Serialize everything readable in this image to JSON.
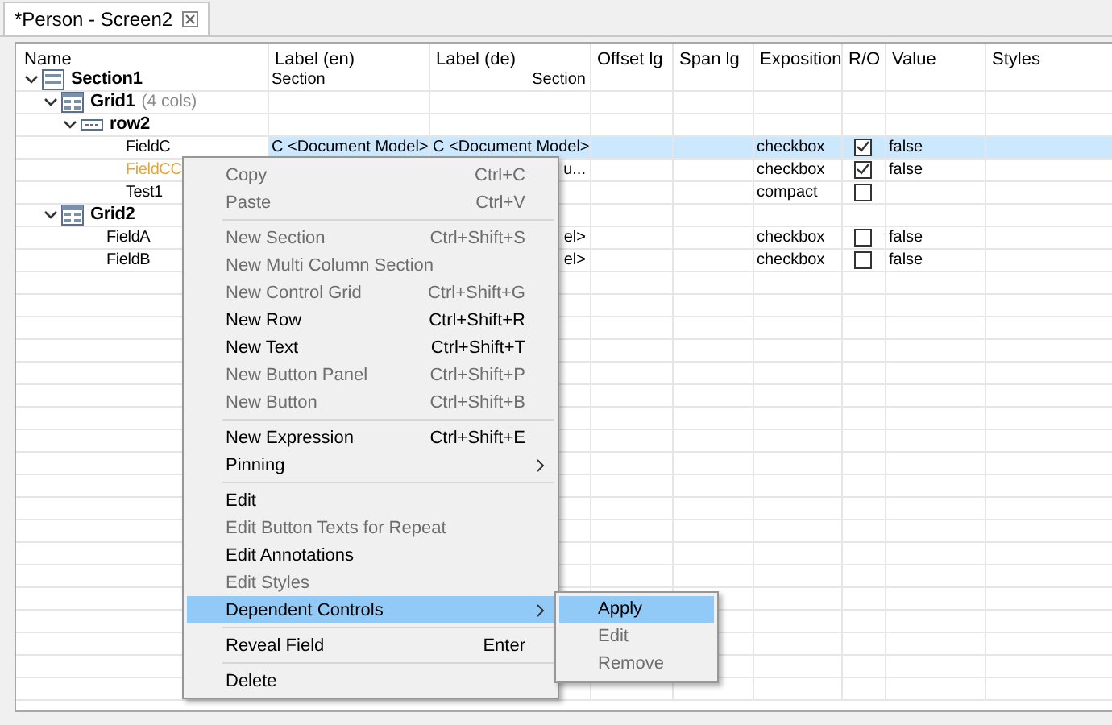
{
  "tab": {
    "title": "*Person - Screen2",
    "selected": true
  },
  "table": {
    "columns": [
      "Name",
      "Label (en)",
      "Label (de)",
      "Offset lg",
      "Span lg",
      "Exposition",
      "R/O",
      "Value",
      "Styles"
    ],
    "rows": [
      {
        "name": "Section1",
        "kind": "section",
        "expanded": true,
        "selected": false,
        "label_en": "Section",
        "label_de": "Section",
        "children": [
          {
            "name": "Grid1",
            "note": "(4 cols)",
            "kind": "grid",
            "expanded": true,
            "selected": false,
            "children": [
              {
                "name": "row2",
                "kind": "row",
                "expanded": true,
                "selected": false,
                "children": [
                  {
                    "name": "FieldC",
                    "color": "#000000",
                    "selected": true,
                    "label_en": "C <Document Model>",
                    "label_de": "C <Document Model>",
                    "exposition": "checkbox",
                    "read_only": true,
                    "value": "false"
                  },
                  {
                    "name": "FieldCC",
                    "color": "#e3a43a",
                    "selected": false,
                    "label_de": "u...",
                    "exposition": "checkbox",
                    "read_only": true,
                    "value": "false"
                  },
                  {
                    "name": "Test1",
                    "color": "#000000",
                    "selected": false,
                    "exposition": "compact",
                    "read_only": false
                  }
                ]
              }
            ]
          },
          {
            "name": "Grid2",
            "kind": "grid",
            "expanded": true,
            "selected": false,
            "children": [
              {
                "name": "FieldA",
                "color": "#000000",
                "selected": false,
                "label_de": "el>",
                "exposition": "checkbox",
                "read_only": false,
                "value": "false"
              },
              {
                "name": "FieldB",
                "color": "#000000",
                "selected": false,
                "label_de": "el>",
                "exposition": "checkbox",
                "read_only": false,
                "value": "false"
              }
            ]
          }
        ]
      }
    ]
  },
  "context_menu": {
    "items": [
      {
        "kind": "item",
        "label": "Copy",
        "shortcut": "Ctrl+C",
        "disabled": true,
        "selected": false
      },
      {
        "kind": "item",
        "label": "Paste",
        "shortcut": "Ctrl+V",
        "disabled": true,
        "selected": false
      },
      {
        "kind": "separator"
      },
      {
        "kind": "item",
        "label": "New Section",
        "shortcut": "Ctrl+Shift+S",
        "disabled": true,
        "selected": false
      },
      {
        "kind": "item",
        "label": "New Multi Column Section",
        "disabled": true,
        "selected": false
      },
      {
        "kind": "item",
        "label": "New Control Grid",
        "shortcut": "Ctrl+Shift+G",
        "disabled": true,
        "selected": false
      },
      {
        "kind": "item",
        "label": "New Row",
        "shortcut": "Ctrl+Shift+R",
        "disabled": false,
        "selected": false
      },
      {
        "kind": "item",
        "label": "New Text",
        "shortcut": "Ctrl+Shift+T",
        "disabled": false,
        "selected": false
      },
      {
        "kind": "item",
        "label": "New Button Panel",
        "shortcut": "Ctrl+Shift+P",
        "disabled": true,
        "selected": false
      },
      {
        "kind": "item",
        "label": "New Button",
        "shortcut": "Ctrl+Shift+B",
        "disabled": true,
        "selected": false
      },
      {
        "kind": "separator"
      },
      {
        "kind": "item",
        "label": "New Expression",
        "shortcut": "Ctrl+Shift+E",
        "disabled": false,
        "selected": false
      },
      {
        "kind": "item",
        "label": "Pinning",
        "has_submenu": true,
        "disabled": false,
        "selected": false
      },
      {
        "kind": "separator"
      },
      {
        "kind": "item",
        "label": "Edit",
        "disabled": false,
        "selected": false
      },
      {
        "kind": "item",
        "label": "Edit Button Texts for Repeat",
        "disabled": true,
        "selected": false
      },
      {
        "kind": "item",
        "label": "Edit Annotations",
        "disabled": false,
        "selected": false
      },
      {
        "kind": "item",
        "label": "Edit Styles",
        "disabled": true,
        "selected": false
      },
      {
        "kind": "item",
        "label": "Dependent Controls",
        "has_submenu": true,
        "disabled": false,
        "selected": true,
        "submenu": [
          {
            "label": "Apply",
            "disabled": false,
            "selected": true
          },
          {
            "label": "Edit",
            "disabled": true,
            "selected": false
          },
          {
            "label": "Remove",
            "disabled": true,
            "selected": false
          }
        ]
      },
      {
        "kind": "separator"
      },
      {
        "kind": "item",
        "label": "Reveal Field",
        "shortcut": "Enter",
        "disabled": false,
        "selected": false
      },
      {
        "kind": "separator"
      },
      {
        "kind": "item",
        "label": "Delete",
        "disabled": false,
        "selected": false
      }
    ]
  }
}
